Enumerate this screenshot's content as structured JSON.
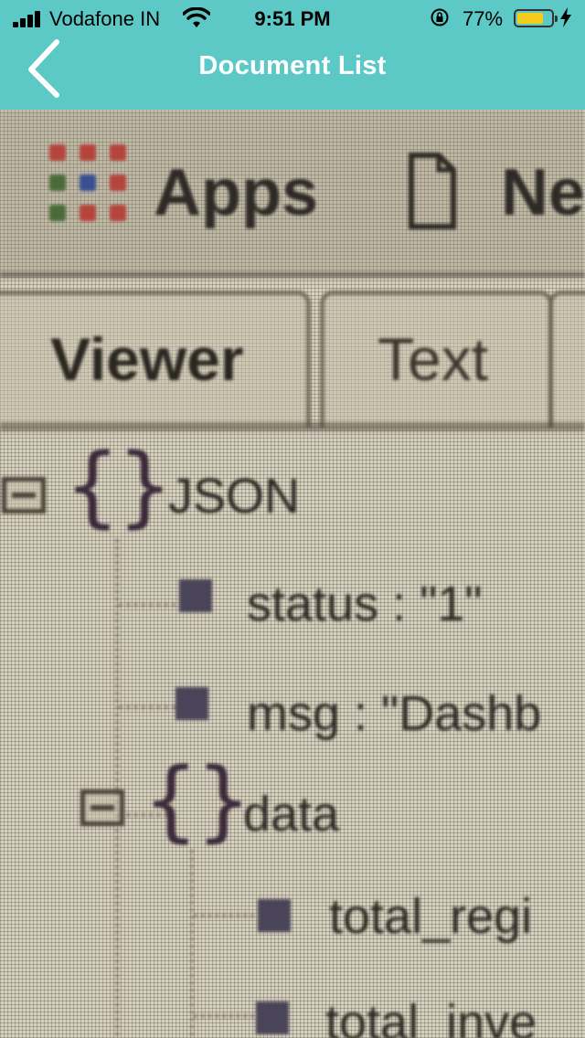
{
  "status_bar": {
    "carrier": "Vodafone IN",
    "time": "9:51 PM",
    "battery_percent": "77%",
    "battery_level": 0.77,
    "icons": [
      "signal-icon",
      "wifi-icon",
      "rotation-lock-icon",
      "battery-icon",
      "charging-bolt-icon"
    ]
  },
  "nav": {
    "title": "Document List",
    "back_icon": "chevron-left-icon"
  },
  "photo": {
    "bookmarks_bar": {
      "apps_label": "Apps",
      "next_label_partial": "Ne"
    },
    "tabs": [
      {
        "label": "Viewer"
      },
      {
        "label": "Text"
      }
    ],
    "tree": {
      "root_label": "JSON",
      "status_entry": "status : \"1\"",
      "msg_entry": "msg : \"Dashb",
      "data_label": "data",
      "total_regi_entry": "total_regi",
      "total_inve_entry": "total_inve"
    }
  },
  "colors": {
    "nav_bar": "#5cc9c6",
    "nav_title": "#ffffff",
    "battery_fill": "#f5cc1b"
  }
}
